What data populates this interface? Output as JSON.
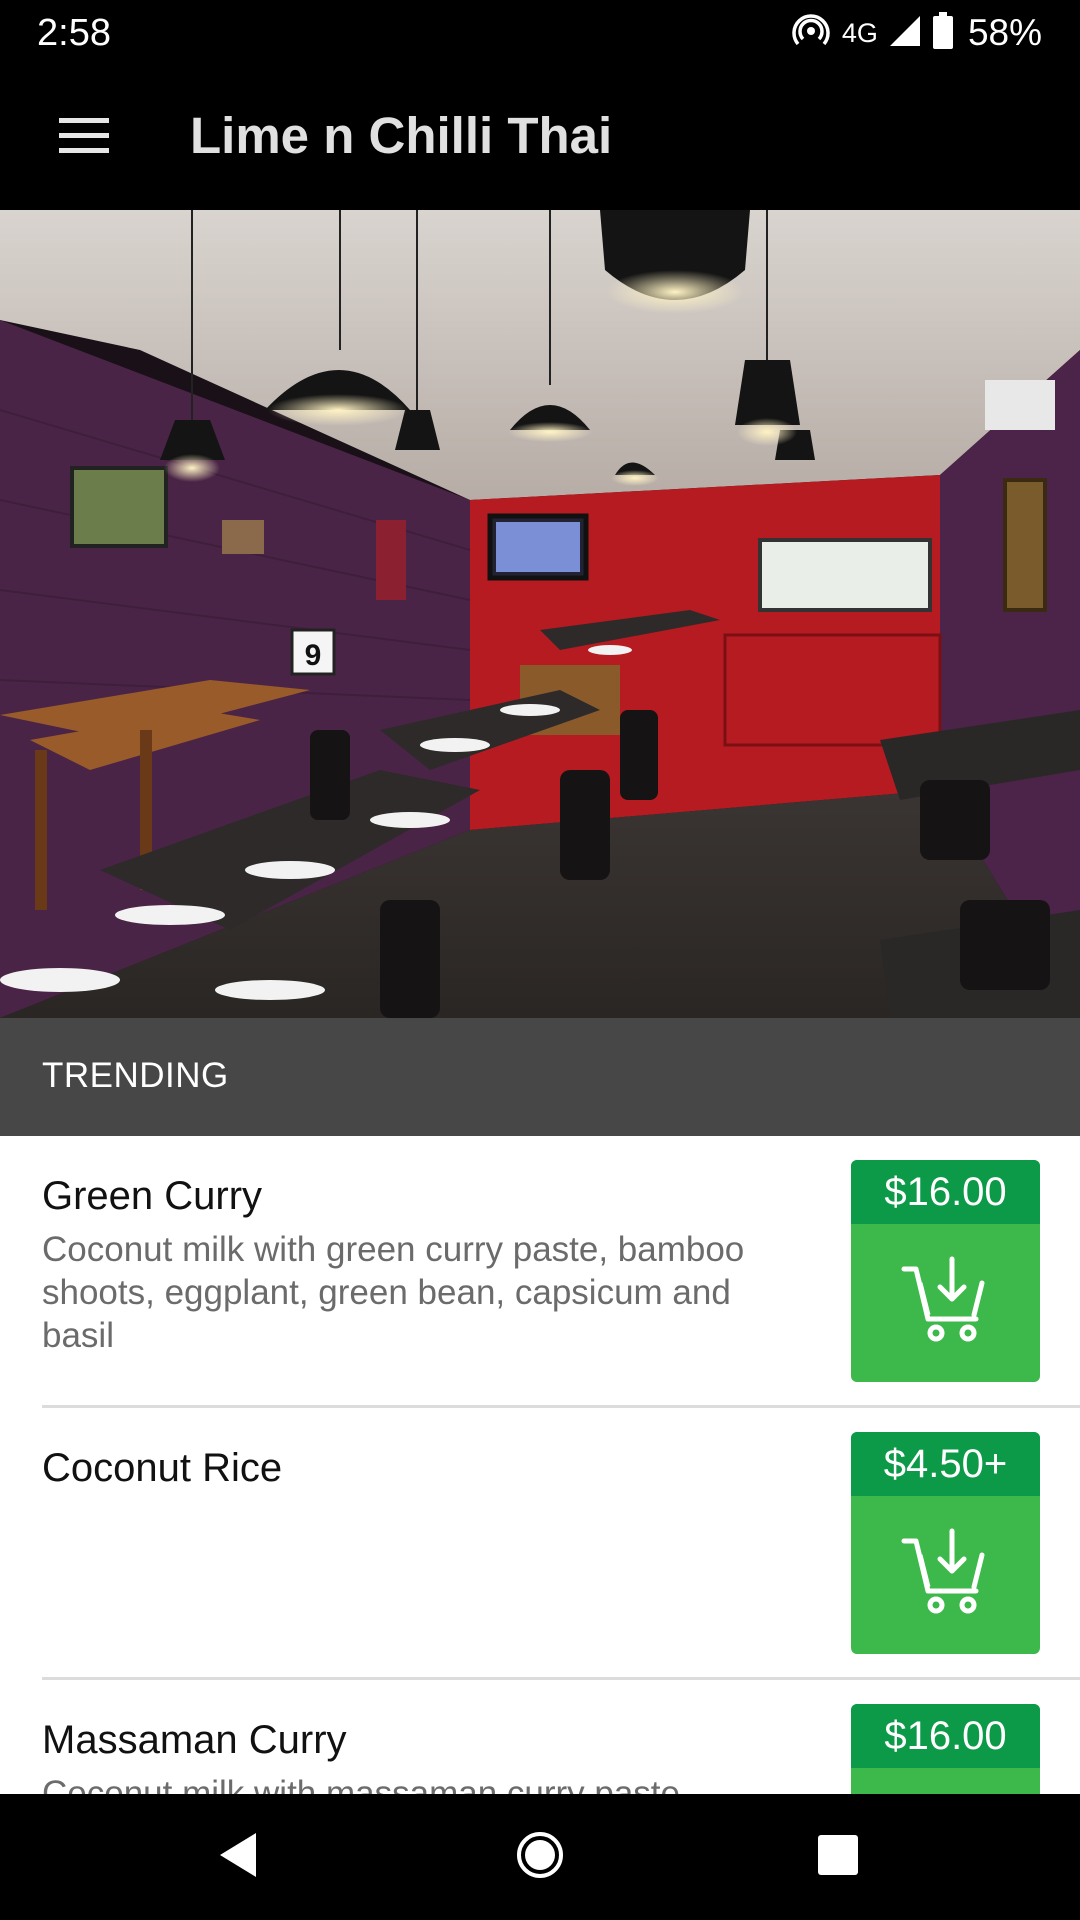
{
  "status_bar": {
    "time": "2:58",
    "network": "4G",
    "battery": "58%",
    "icons": [
      "hotspot-icon",
      "signal-icon",
      "battery-icon"
    ]
  },
  "app_bar": {
    "title": "Lime n Chilli Thai",
    "menu_icon": "hamburger-menu-icon"
  },
  "hero": {
    "description_icon": "restaurant-photo",
    "table_number": "9"
  },
  "trending": {
    "title": "TRENDING",
    "items": [
      {
        "name": "Green Curry",
        "description": "Coconut milk with green curry paste, bamboo shoots, eggplant, green bean, capsicum and basil",
        "price": "$16.00"
      },
      {
        "name": "Coconut Rice",
        "description": "",
        "price": "$4.50+"
      },
      {
        "name": "Massaman Curry",
        "description": "Coconut milk with massaman curry paste",
        "price": "$16.00"
      }
    ]
  },
  "nav_bar": {
    "back_icon": "back-triangle-icon",
    "home_icon": "home-circle-icon",
    "recents_icon": "recents-square-icon"
  },
  "colors": {
    "price_bg": "#0d9a48",
    "cart_bg": "#3cb94a",
    "section_header_bg": "#474747",
    "bars_bg": "#000000"
  }
}
